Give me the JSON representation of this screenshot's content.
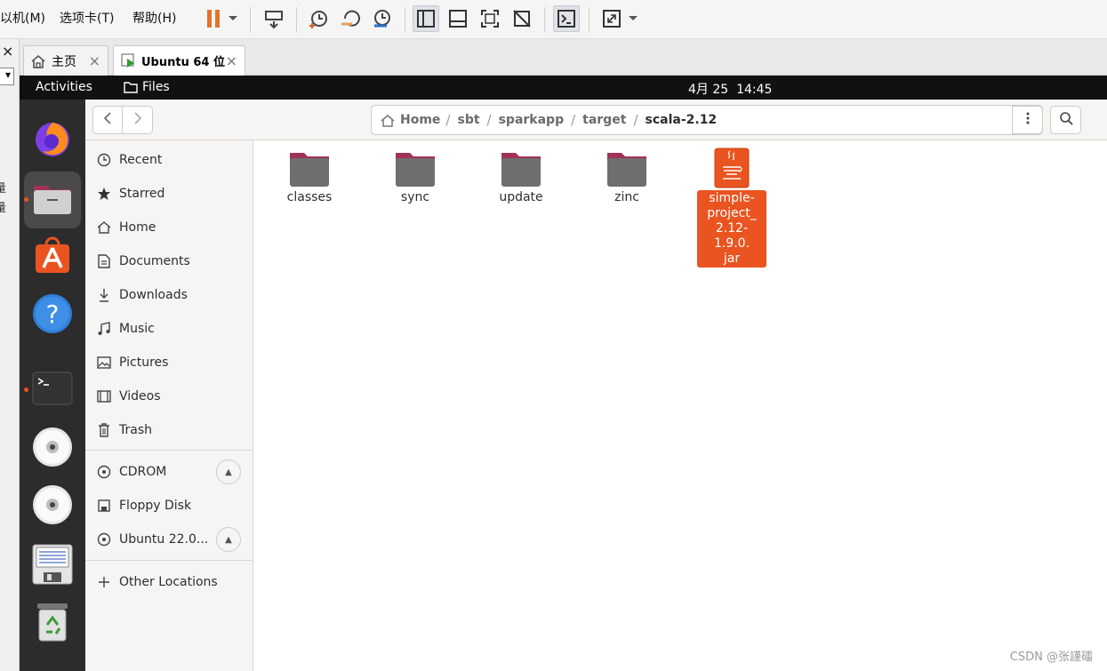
{
  "vm_menu": {
    "items": [
      "以机(M)",
      "选项卡(T)",
      "帮助(H)"
    ]
  },
  "vm_tabs": [
    {
      "label": "主页",
      "icon": "home-icon"
    },
    {
      "label": "Ubuntu 64 位",
      "icon": "vm-running-icon"
    }
  ],
  "left_strip": {
    "close_glyph": "×",
    "dropdown_glyph": "▾",
    "side_chars": "量 量"
  },
  "topbar": {
    "activities": "Activities",
    "app_name": "Files",
    "clock": "4月 25  14:45"
  },
  "dock": {
    "items": [
      "firefox-icon",
      "files-icon",
      "app-store-icon",
      "help-icon",
      "terminal-icon",
      "cdrom-icon",
      "cdrom-icon",
      "floppy-icon",
      "trash-icon"
    ],
    "running_colors": {
      "dot": "#e95420"
    }
  },
  "pathbar": {
    "home": "Home",
    "crumbs": [
      "sbt",
      "sparkapp",
      "target",
      "scala-2.12"
    ]
  },
  "sidebar": {
    "places": [
      {
        "label": "Recent",
        "icon": "clock-icon"
      },
      {
        "label": "Starred",
        "icon": "star-icon"
      },
      {
        "label": "Home",
        "icon": "home-icon"
      },
      {
        "label": "Documents",
        "icon": "document-icon"
      },
      {
        "label": "Downloads",
        "icon": "download-icon"
      },
      {
        "label": "Music",
        "icon": "music-icon"
      },
      {
        "label": "Pictures",
        "icon": "picture-icon"
      },
      {
        "label": "Videos",
        "icon": "video-icon"
      },
      {
        "label": "Trash",
        "icon": "trash-icon"
      }
    ],
    "devices": [
      {
        "label": "CDROM",
        "icon": "disc-icon",
        "eject": true
      },
      {
        "label": "Floppy Disk",
        "icon": "floppy-icon",
        "eject": false
      },
      {
        "label": "Ubuntu 22.0...",
        "icon": "disc-icon",
        "eject": true
      }
    ],
    "other": {
      "label": "Other Locations",
      "icon": "plus-icon"
    }
  },
  "files": [
    {
      "name": "classes",
      "type": "folder"
    },
    {
      "name": "sync",
      "type": "folder"
    },
    {
      "name": "update",
      "type": "folder"
    },
    {
      "name": "zinc",
      "type": "folder"
    },
    {
      "name": "simple-\nproject_\n2.12-1.9.0.\njar",
      "type": "jar",
      "selected": true
    }
  ],
  "colors": {
    "accent": "#e95420",
    "folder": "#6f6f6f",
    "folder_tab": "#a2325a"
  },
  "watermark": "CSDN @张謹礌"
}
